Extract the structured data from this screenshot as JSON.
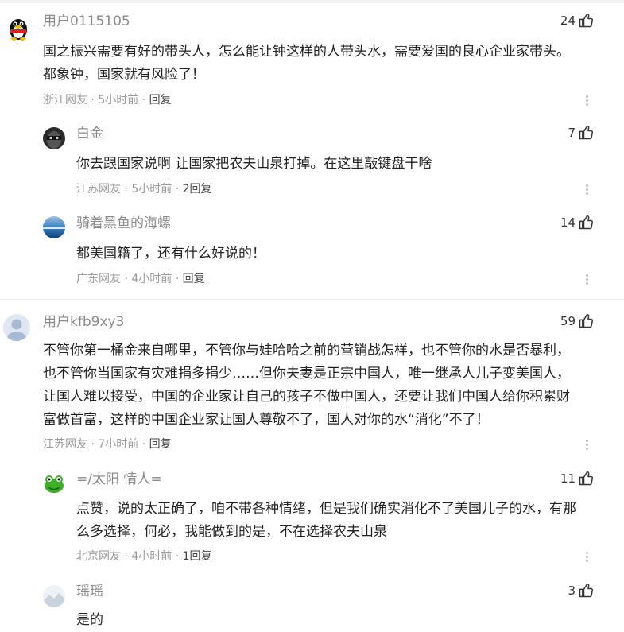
{
  "comments": [
    {
      "user": "用户0115105",
      "likes": "24",
      "lines": [
        "国之振兴需要有好的带头人，怎么能让钟这样的人带头水，需要爱国的良心企业家带头。",
        "都象钟，国家就有风险了！"
      ],
      "location": "浙江网友",
      "time": "5小时前",
      "reply": "回复"
    },
    {
      "user": "白金",
      "likes": "7",
      "lines": [
        "你去跟国家说啊 让国家把农夫山泉打掉。在这里敲键盘干啥"
      ],
      "location": "江苏网友",
      "time": "5小时前",
      "reply": "2回复"
    },
    {
      "user": "骑着黑鱼的海螺",
      "likes": "14",
      "lines": [
        "都美国籍了，还有什么好说的！"
      ],
      "location": "广东网友",
      "time": "4小时前",
      "reply": "回复"
    },
    {
      "user": "用户kfb9xy3",
      "likes": "59",
      "lines": [
        "不管你第一桶金来自哪里，不管你与娃哈哈之前的营销战怎样，也不管你的水是否暴利，",
        "也不管你当国家有灾难捐多捐少……但你夫妻是正宗中国人，唯一继承人儿子变美国人，",
        "让国人难以接受，中国的企业家让自己的孩子不做中国人，还要让我们中国人给你积累财",
        "富做首富，这样的中国企业家让国人尊敬不了，国人对你的水“消化”不了！"
      ],
      "location": "江苏网友",
      "time": "7小时前",
      "reply": "回复"
    },
    {
      "user": "=/太阳 情人=",
      "likes": "11",
      "lines": [
        "点赞，说的太正确了，咱不带各种情绪，但是我们确实消化不了美国儿子的水，有那",
        "么多选择，何必，我能做到的是，不在选择农夫山泉"
      ],
      "location": "北京网友",
      "time": "4小时前",
      "reply": "1回复"
    },
    {
      "user": "瑶瑶",
      "likes": "3",
      "lines": [
        "是的"
      ],
      "location": "",
      "time": "",
      "reply": ""
    }
  ],
  "icons": {
    "like": "thumbs-up-icon",
    "more": "more-vertical-icon"
  }
}
